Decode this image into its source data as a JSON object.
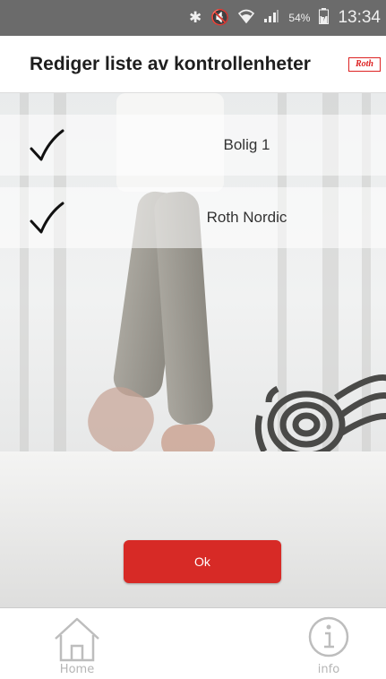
{
  "status_bar": {
    "battery_percent": "54%",
    "time": "13:34"
  },
  "header": {
    "title": "Rediger liste av kontrollenheter",
    "logo_text": "Roth"
  },
  "devices": [
    {
      "label": "Bolig 1",
      "checked": true
    },
    {
      "label": "Roth Nordic",
      "checked": true
    }
  ],
  "ok_button": {
    "label": "Ok"
  },
  "tabbar": {
    "home_label": "Home",
    "info_label": "info"
  },
  "colors": {
    "accent": "#d72a26",
    "status_bar": "#6b6b6b"
  }
}
